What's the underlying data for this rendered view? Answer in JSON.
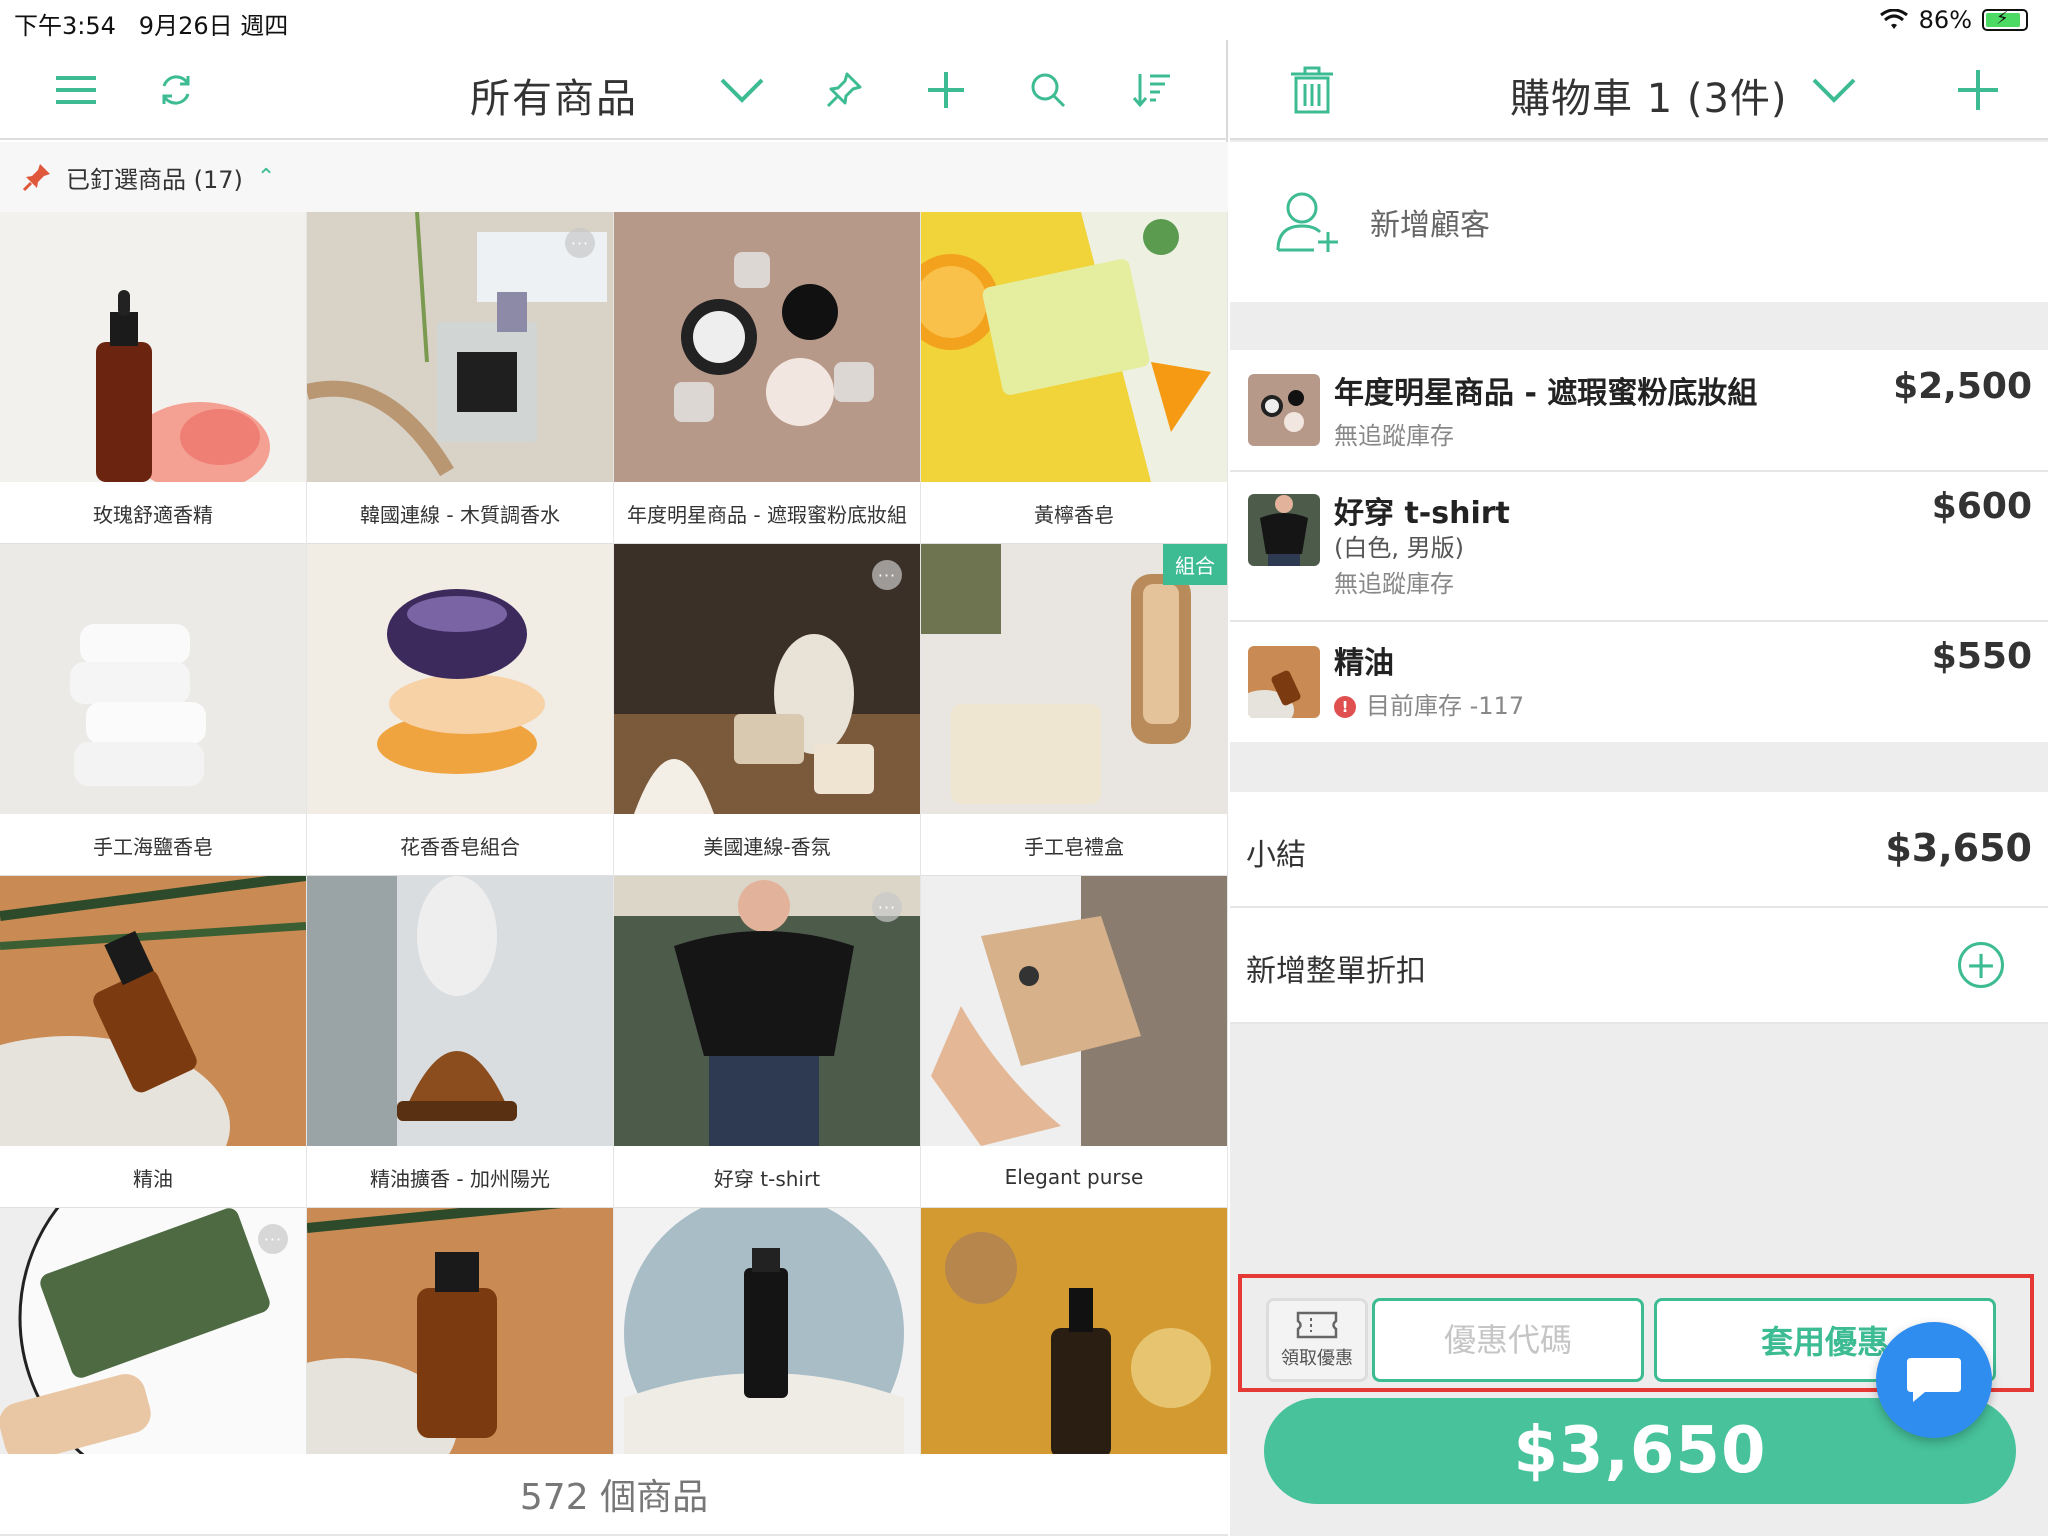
{
  "status_bar": {
    "time": "下午3:54",
    "date": "9月26日 週四",
    "battery": "86%"
  },
  "colors": {
    "accent": "#3dbb93",
    "checkout": "#47c29b",
    "alert": "#e53935",
    "chat": "#2f8df0"
  },
  "products_panel": {
    "title": "所有商品",
    "pinned_label": "已釘選商品 (17)",
    "footer_count": "572 個商品",
    "items": [
      {
        "name": "玫瑰舒適香精"
      },
      {
        "name": "韓國連線 - 木質調香水"
      },
      {
        "name": "年度明星商品 - 遮瑕蜜粉底妝組"
      },
      {
        "name": "黃檸香皂"
      },
      {
        "name": "手工海鹽香皂"
      },
      {
        "name": "花香香皂組合"
      },
      {
        "name": "美國連線-香氛"
      },
      {
        "name": "手工皂禮盒",
        "badge": "組合"
      },
      {
        "name": "精油"
      },
      {
        "name": "精油擴香 - 加州陽光"
      },
      {
        "name": "好穿 t-shirt"
      },
      {
        "name": "Elegant purse"
      },
      {
        "name": ""
      },
      {
        "name": ""
      },
      {
        "name": ""
      },
      {
        "name": ""
      }
    ]
  },
  "cart_panel": {
    "title": "購物車 1 (3件)",
    "add_customer": "新增顧客",
    "items": [
      {
        "title": "年度明星商品 - 遮瑕蜜粉底妝組",
        "sub1": "無追蹤庫存",
        "price": "$2,500"
      },
      {
        "title": "好穿 t-shirt",
        "sub1": "(白色, 男版)",
        "sub2": "無追蹤庫存",
        "price": "$600"
      },
      {
        "title": "精油",
        "sub1": "目前庫存 -117",
        "price": "$550"
      }
    ],
    "subtotal_label": "小結",
    "subtotal_value": "$3,650",
    "discount_label": "新增整單折扣",
    "coupon_get_label": "領取優惠",
    "coupon_placeholder": "優惠代碼",
    "coupon_apply_label": "套用優惠",
    "checkout_total": "$3,650"
  }
}
